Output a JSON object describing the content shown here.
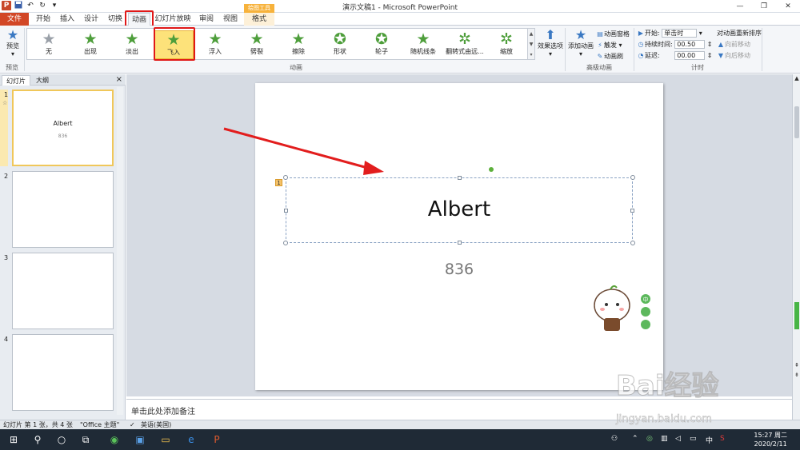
{
  "window": {
    "title": "演示文稿1 - Microsoft PowerPoint",
    "logo": "P",
    "qat": [
      "save-icon",
      "undo-icon",
      "redo-icon",
      "customize-icon"
    ],
    "controls": {
      "minimize": "—",
      "restore": "❐",
      "close": "✕"
    }
  },
  "tabs": [
    {
      "name": "file",
      "label": "文件"
    },
    {
      "name": "home",
      "label": "开始"
    },
    {
      "name": "insert",
      "label": "插入"
    },
    {
      "name": "design",
      "label": "设计"
    },
    {
      "name": "transitions",
      "label": "切换"
    },
    {
      "name": "animations",
      "label": "动画",
      "active": true
    },
    {
      "name": "slideshow",
      "label": "幻灯片放映"
    },
    {
      "name": "review",
      "label": "审阅"
    },
    {
      "name": "view",
      "label": "视图"
    },
    {
      "name": "format",
      "label": "格式"
    }
  ],
  "context_tab_header": "绘图工具",
  "ribbon": {
    "preview": {
      "label": "预览",
      "group": "预览"
    },
    "animations_group": "动画",
    "gallery": [
      {
        "label": "无",
        "icon": "star-grey-icon"
      },
      {
        "label": "出现",
        "icon": "star-appear-icon"
      },
      {
        "label": "淡出",
        "icon": "star-fade-icon"
      },
      {
        "label": "飞入",
        "icon": "star-fly-icon",
        "selected": true
      },
      {
        "label": "浮入",
        "icon": "star-float-icon"
      },
      {
        "label": "劈裂",
        "icon": "star-split-icon"
      },
      {
        "label": "擦除",
        "icon": "star-wipe-icon"
      },
      {
        "label": "形状",
        "icon": "star-shape-icon"
      },
      {
        "label": "轮子",
        "icon": "star-wheel-icon"
      },
      {
        "label": "随机线条",
        "icon": "star-random-icon"
      },
      {
        "label": "翻转式由远...",
        "icon": "star-flip-icon"
      },
      {
        "label": "缩放",
        "icon": "star-zoom-icon"
      }
    ],
    "effect_options": "效果选项",
    "advanced": {
      "group": "高级动画",
      "add_animation": "添加动画",
      "animation_pane": "动画窗格",
      "trigger": "触发",
      "painter": "动画刷"
    },
    "timing": {
      "group": "计时",
      "start_label": "开始:",
      "start_value": "单击时",
      "duration_label": "持续时间:",
      "duration_value": "00.50",
      "delay_label": "延迟:",
      "delay_value": "00.00",
      "reorder": "对动画重新排序",
      "move_earlier": "向前移动",
      "move_later": "向后移动"
    }
  },
  "panel": {
    "tab_slides": "幻灯片",
    "tab_outline": "大纲",
    "close": "×",
    "slides": [
      {
        "num": "1",
        "title": "Albert",
        "sub": "836",
        "selected": true
      },
      {
        "num": "2"
      },
      {
        "num": "3"
      },
      {
        "num": "4"
      }
    ]
  },
  "slide": {
    "title": "Albert",
    "subtitle": "836",
    "anim_tag": "1"
  },
  "notes_placeholder": "单击此处添加备注",
  "status": {
    "slide_info": "幻灯片 第 1 张，共 4 张",
    "theme": "\"Office 主题\"",
    "language": "英语(美国)"
  },
  "taskbar": {
    "time": "15:27 周二",
    "date": "2020/2/11",
    "ime": "中"
  },
  "watermark": {
    "brand": "Bai经验",
    "url": "jingyan.baidu.com"
  },
  "colors": {
    "accent": "#d24726",
    "highlight": "#e01818",
    "selected": "#fde27a"
  }
}
